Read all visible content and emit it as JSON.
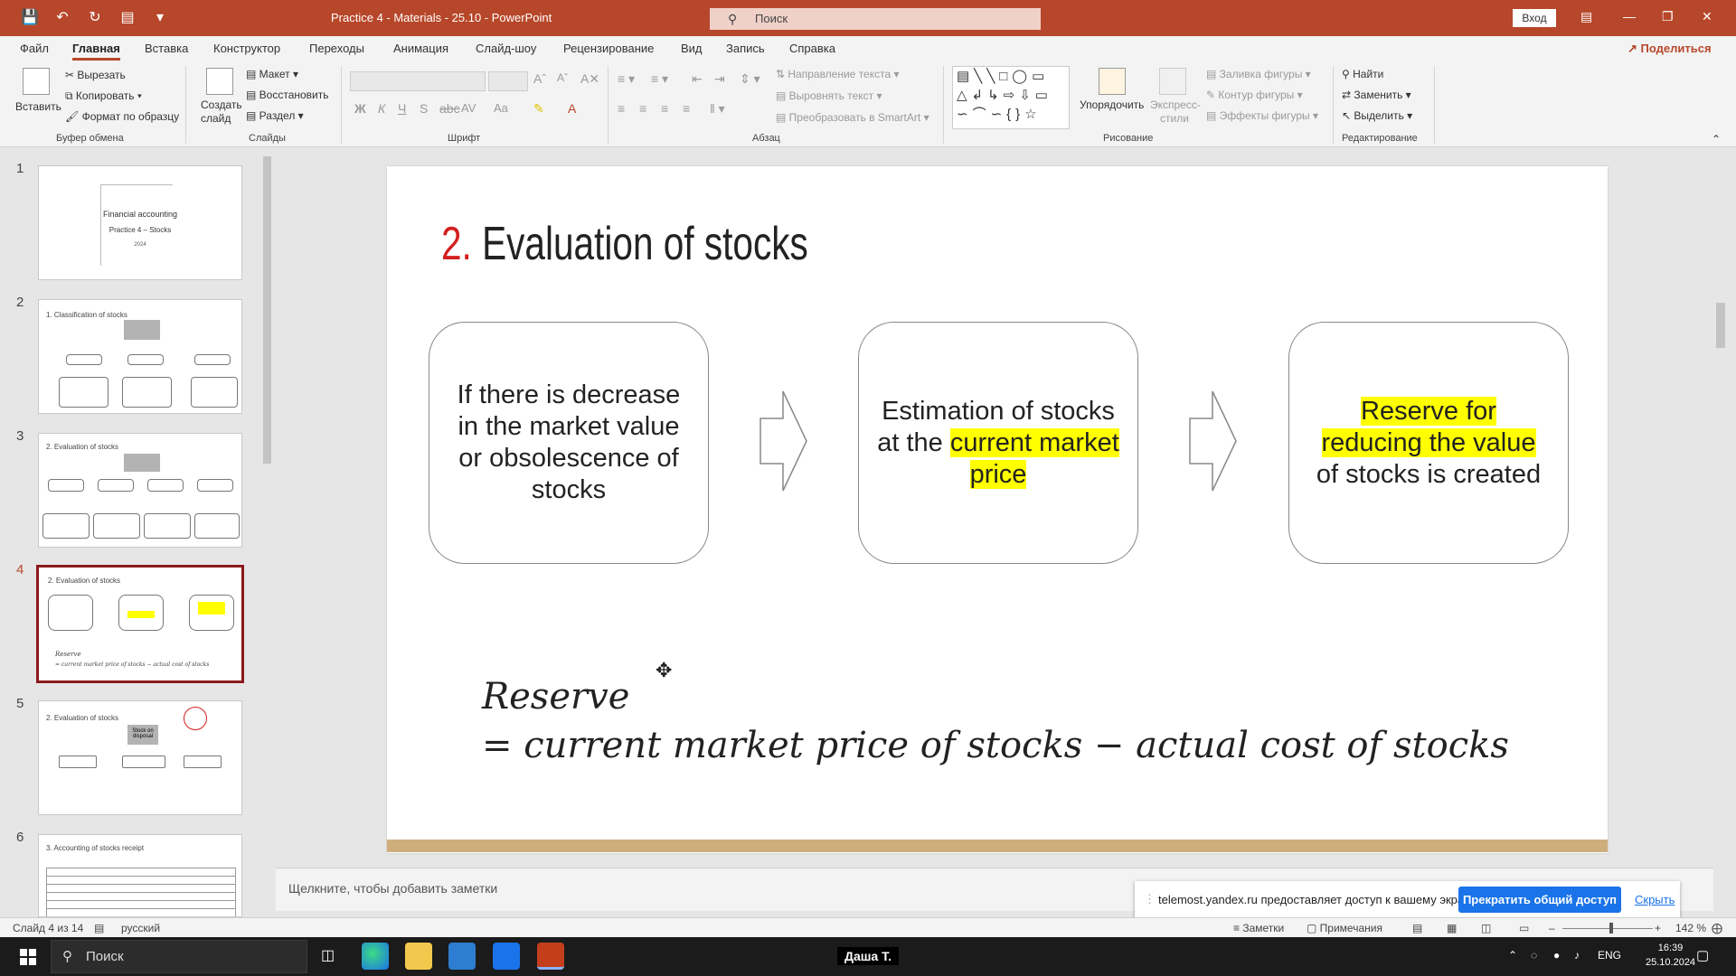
{
  "titlebar": {
    "title": "Practice 4 - Materials - 25.10  -  PowerPoint",
    "search_placeholder": "Поиск",
    "signin": "Вход"
  },
  "menu": {
    "tabs": [
      "Файл",
      "Главная",
      "Вставка",
      "Конструктор",
      "Переходы",
      "Анимация",
      "Слайд-шоу",
      "Рецензирование",
      "Вид",
      "Запись",
      "Справка"
    ],
    "active_tab": "Главная",
    "share": "Поделиться"
  },
  "ribbon": {
    "clipboard": {
      "paste": "Вставить",
      "cut": "Вырезать",
      "copy": "Копировать",
      "format_painter": "Формат по образцу",
      "label": "Буфер обмена"
    },
    "slides": {
      "new_slide": "Создать слайд",
      "layout": "Макет",
      "reset": "Восстановить",
      "section": "Раздел",
      "label": "Слайды"
    },
    "font": {
      "label": "Шрифт"
    },
    "paragraph": {
      "text_direction": "Направление текста",
      "align_text": "Выровнять текст",
      "convert_smartart": "Преобразовать в SmartArt",
      "label": "Абзац"
    },
    "drawing": {
      "arrange": "Упорядочить",
      "quick_styles": "Экспресс-стили",
      "shape_fill": "Заливка фигуры",
      "shape_outline": "Контур фигуры",
      "shape_effects": "Эффекты фигуры",
      "label": "Рисование"
    },
    "editing": {
      "find": "Найти",
      "replace": "Заменить",
      "select": "Выделить",
      "label": "Редактирование"
    }
  },
  "thumbnails": {
    "numbers": [
      "1",
      "2",
      "3",
      "4",
      "5",
      "6"
    ],
    "slide1": {
      "title": "Financial accounting",
      "subtitle": "Practice 4 – Stocks",
      "small": "2024"
    },
    "slide2": {
      "title": "1. Classification of stocks"
    },
    "slide3": {
      "title": "2. Evaluation of stocks"
    },
    "slide4": {
      "title": "2. Evaluation of stocks",
      "formula1": "Reserve",
      "formula2": "= current market price of stocks − actual cost of stocks"
    },
    "slide5": {
      "title": "2. Evaluation of stocks",
      "box": "Stock on disposal"
    },
    "slide6": {
      "title": "3. Accounting of stocks receipt"
    }
  },
  "slide": {
    "title_number": "2.",
    "title_text": " Evaluation of stocks",
    "box1": "If there is decrease in the market value or obsolescence of stocks",
    "box2_pre": "Estimation of stocks at the ",
    "box2_hl": "current market price",
    "box3_hl": "Reserve for reducing the value",
    "box3_post": " of stocks is created",
    "formula_line1": "Reserve",
    "formula_line2": "= current market price of  stocks  − actual cost of  stocks"
  },
  "notes": {
    "placeholder": "Щелкните, чтобы добавить заметки"
  },
  "banner": {
    "text": "telemost.yandex.ru предоставляет доступ к вашему экрану.",
    "stop": "Прекратить общий доступ",
    "hide": "Скрыть"
  },
  "status": {
    "slide_count": "Слайд 4 из 14",
    "language": "русский",
    "notes": "Заметки",
    "comments": "Примечания",
    "zoom": "142 %"
  },
  "taskbar": {
    "search": "Поиск",
    "user_label": "Даша Т.",
    "lang": "ENG",
    "time": "16:39",
    "date": "25.10.2024"
  },
  "colors": {
    "accent": "#b7472a",
    "highlight": "#ffff00",
    "title_number": "#d42020",
    "banner_button": "#1a73e8"
  }
}
